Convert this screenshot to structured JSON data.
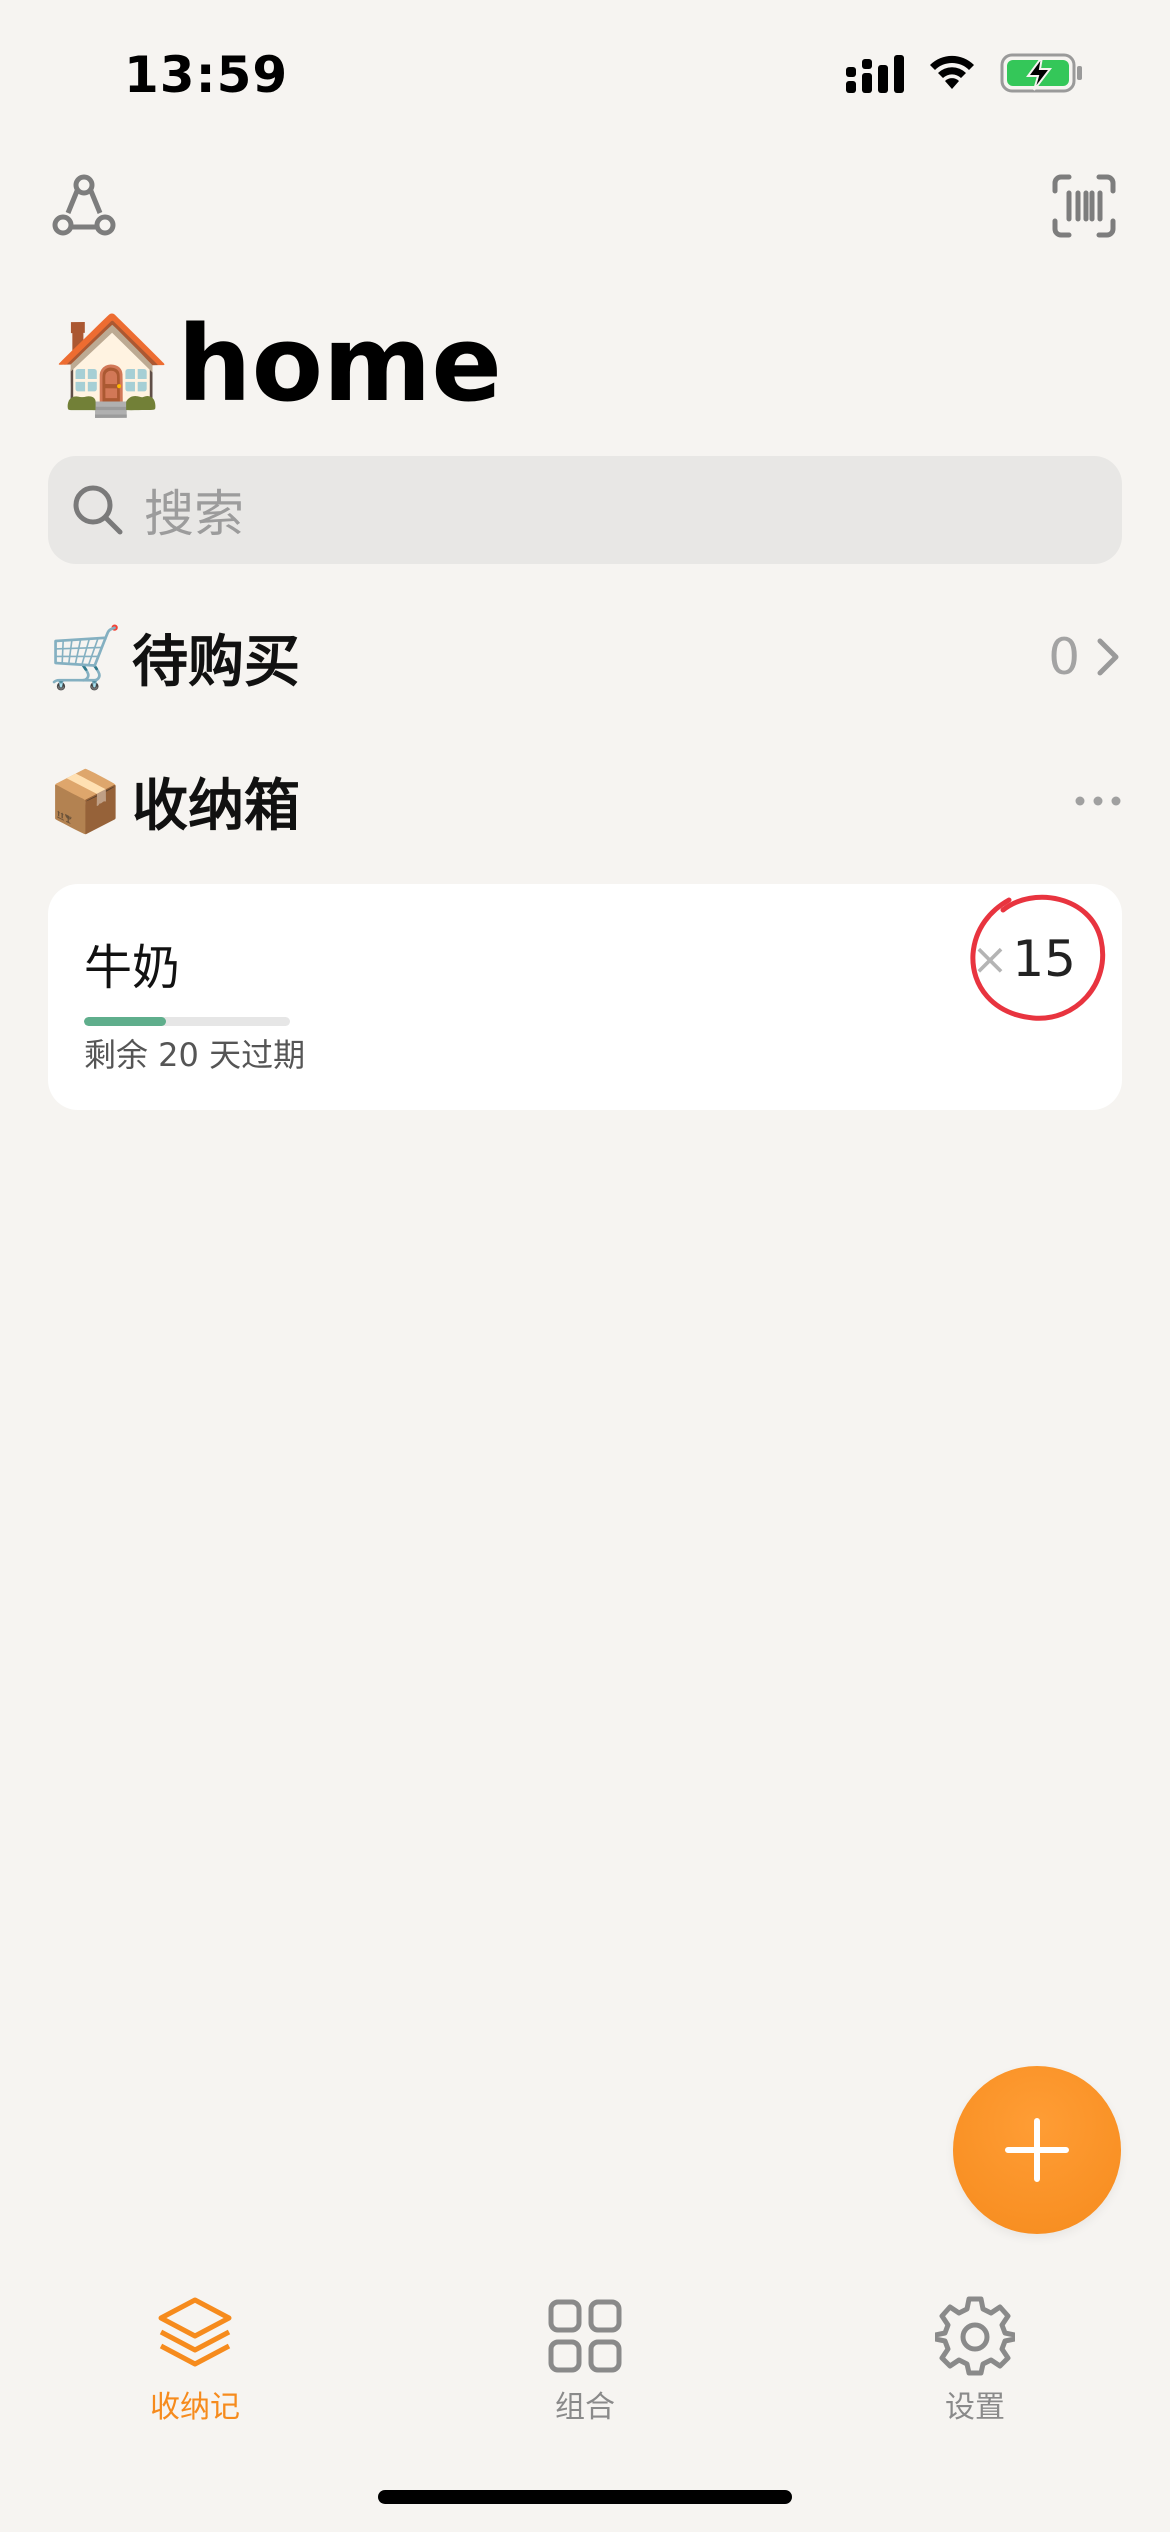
{
  "status_bar": {
    "time": "13:59",
    "battery": "charging"
  },
  "header": {
    "left_icon": "share-network-icon",
    "right_icon": "barcode-scan-icon"
  },
  "title": {
    "emoji": "🏠",
    "text": "home"
  },
  "search": {
    "placeholder": "搜索"
  },
  "sections": [
    {
      "emoji": "🛒",
      "label": "待购买",
      "count": "0"
    },
    {
      "emoji": "📦",
      "label": "收纳箱"
    }
  ],
  "items": [
    {
      "name": "牛奶",
      "expiry_text": "剩余 20 天过期",
      "quantity_prefix": "×",
      "quantity": "15",
      "remaining_fraction": 0.4
    }
  ],
  "tabs": [
    {
      "label": "收纳记",
      "icon": "layers-icon",
      "active": true
    },
    {
      "label": "组合",
      "icon": "grid-icon",
      "active": false
    },
    {
      "label": "设置",
      "icon": "gear-icon",
      "active": false
    }
  ],
  "colors": {
    "accent": "#f68b1d",
    "progress": "#5fae8c",
    "annotation_circle": "#e8343f",
    "inactive_tab": "#8a8a8a"
  }
}
